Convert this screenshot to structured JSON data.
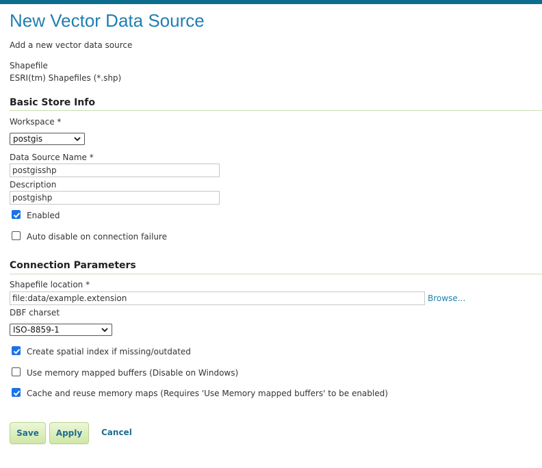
{
  "header": {
    "title": "New Vector Data Source",
    "subtitle": "Add a new vector data source"
  },
  "store_type": {
    "name": "Shapefile",
    "description": "ESRI(tm) Shapefiles (*.shp)"
  },
  "basic_info": {
    "heading": "Basic Store Info",
    "workspace_label": "Workspace *",
    "workspace_value": "postgis",
    "name_label": "Data Source Name *",
    "name_value": "postgisshp",
    "description_label": "Description",
    "description_value": "postgishp",
    "enabled_label": "Enabled",
    "enabled_checked": true,
    "auto_disable_label": "Auto disable on connection failure",
    "auto_disable_checked": false
  },
  "connection": {
    "heading": "Connection Parameters",
    "location_label": "Shapefile location *",
    "location_value": "file:data/example.extension",
    "browse_label": "Browse...",
    "charset_label": "DBF charset",
    "charset_value": "ISO-8859-1",
    "spatial_index_label": "Create spatial index if missing/outdated",
    "spatial_index_checked": true,
    "memory_mapped_label": "Use memory mapped buffers (Disable on Windows)",
    "memory_mapped_checked": false,
    "cache_maps_label": "Cache and reuse memory maps (Requires 'Use Memory mapped buffers' to be enabled)",
    "cache_maps_checked": true
  },
  "actions": {
    "save_label": "Save",
    "apply_label": "Apply",
    "cancel_label": "Cancel"
  },
  "colors": {
    "accent": "#1f7fb0",
    "topbar": "#0b6e8e",
    "checkbox_checked": "#1a73e8",
    "button_green": "#cfe7a6"
  },
  "icons": {
    "select_chevron": "chevron-down-icon",
    "checkbox_check": "check-icon"
  }
}
